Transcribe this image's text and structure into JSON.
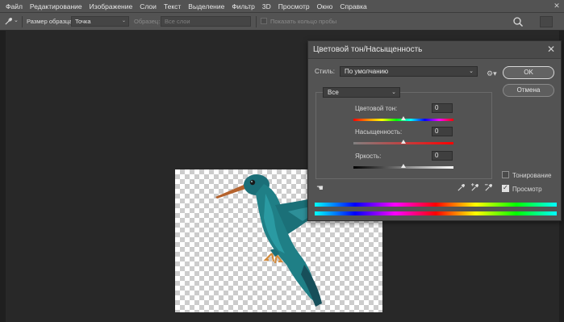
{
  "menu": [
    "Файл",
    "Редактирование",
    "Изображение",
    "Слои",
    "Текст",
    "Выделение",
    "Фильтр",
    "3D",
    "Просмотр",
    "Окно",
    "Справка"
  ],
  "options": {
    "sample_size_label": "Размер образца:",
    "sample_size_value": "Точка",
    "sample_label": "Образец:",
    "sample_value": "Все слои",
    "show_ring_label": "Показать кольцо пробы"
  },
  "dialog": {
    "title": "Цветовой тон/Насыщенность",
    "style_label": "Стиль:",
    "style_value": "По умолчанию",
    "ok_label": "OK",
    "cancel_label": "Отмена",
    "channel_value": "Все",
    "hue_label": "Цветовой тон:",
    "hue_value": "0",
    "saturation_label": "Насыщенность:",
    "saturation_value": "0",
    "lightness_label": "Яркость:",
    "lightness_value": "0",
    "colorize_label": "Тонирование",
    "colorize_checked": false,
    "preview_label": "Просмотр",
    "preview_checked": true
  },
  "icons": {
    "tool": "eyedropper-icon",
    "gear": "gear-icon",
    "hand": "targeted-adjustment-icon",
    "droppers": [
      "eyedropper-icon",
      "eyedropper-plus-icon",
      "eyedropper-minus-icon"
    ],
    "search": "search-icon",
    "close": "close-icon"
  },
  "colors": {
    "ui_bg": "#535353",
    "workspace": "#282828",
    "bird_body": "#1f7f86",
    "beak": "#b5622c"
  }
}
